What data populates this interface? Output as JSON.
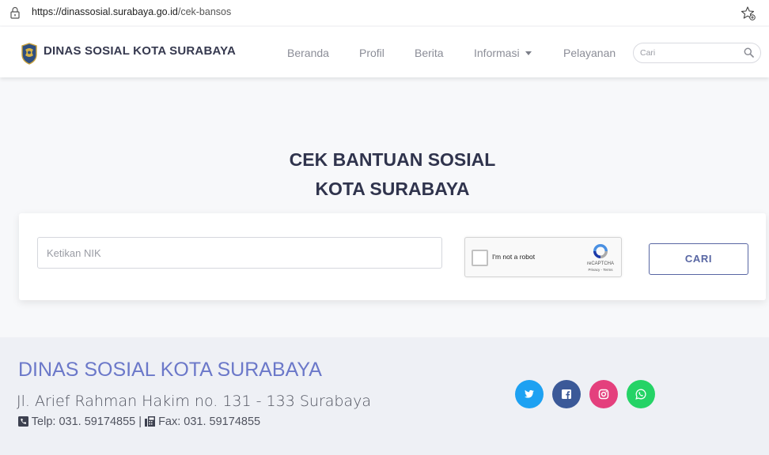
{
  "browser": {
    "url_host": "https://dinassosial.surabaya.go.id",
    "url_path": "/cek-bansos"
  },
  "navbar": {
    "brand": "DINAS SOSIAL KOTA SURABAYA",
    "items": [
      {
        "label": "Beranda"
      },
      {
        "label": "Profil"
      },
      {
        "label": "Berita"
      },
      {
        "label": "Informasi",
        "has_dropdown": true
      },
      {
        "label": "Pelayanan"
      }
    ],
    "search_placeholder": "Cari"
  },
  "main": {
    "title_line1": "CEK BANTUAN SOSIAL",
    "title_line2": "KOTA SURABAYA",
    "nik_placeholder": "Ketikan NIK",
    "recaptcha_label": "I'm not a robot",
    "recaptcha_brand": "reCAPTCHA",
    "recaptcha_links": "Privacy - Terms",
    "submit_label": "CARI"
  },
  "footer": {
    "title": "DINAS SOSIAL KOTA SURABAYA",
    "address": "Jl. Arief Rahman Hakim no. 131 - 133 Surabaya",
    "telp": "Telp: 031. 59174855",
    "separator": "|",
    "fax": "Fax: 031. 59174855"
  },
  "social_icons": [
    {
      "icon": "twitter-icon",
      "color": "#1da1f2"
    },
    {
      "icon": "facebook-icon",
      "color": "#3b5998"
    },
    {
      "icon": "instagram-icon",
      "color": "#e4407d"
    },
    {
      "icon": "whatsapp-icon",
      "color": "#25d366"
    }
  ],
  "colors": {
    "accent": "#5866a3",
    "footer_title": "#6b78c9",
    "heading": "#30344d"
  }
}
